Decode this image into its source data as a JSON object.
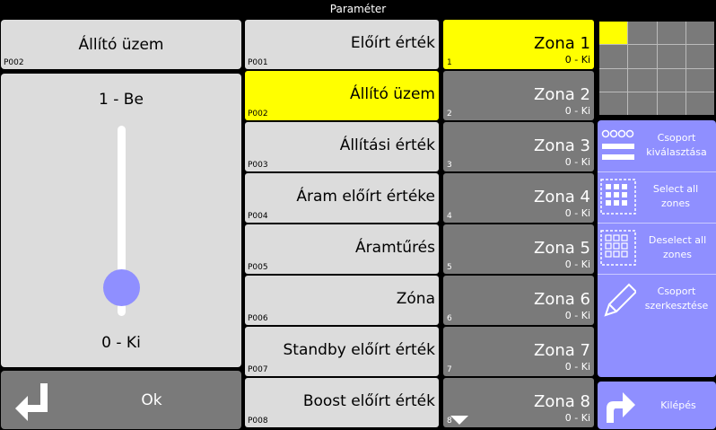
{
  "title": "Paraméter",
  "left_panel": {
    "selected_name": "Állító üzem",
    "selected_code": "P002",
    "slider": {
      "top_label": "1 - Be",
      "bottom_label": "0 - Ki",
      "value": 0
    },
    "ok_label": "Ok"
  },
  "params": [
    {
      "label": "Előírt érték",
      "code": "P001"
    },
    {
      "label": "Állító üzem",
      "code": "P002"
    },
    {
      "label": "Állítási érték",
      "code": "P003"
    },
    {
      "label": "Áram előírt értéke",
      "code": "P004"
    },
    {
      "label": "Áramtűrés",
      "code": "P005"
    },
    {
      "label": "Zóna",
      "code": "P006"
    },
    {
      "label": "Standby előírt érték",
      "code": "P007"
    },
    {
      "label": "Boost előírt érték",
      "code": "P008"
    }
  ],
  "zones": [
    {
      "name": "Zona 1",
      "value": "0 - Ki",
      "num": "1"
    },
    {
      "name": "Zona 2",
      "value": "0 - Ki",
      "num": "2"
    },
    {
      "name": "Zona 3",
      "value": "0 - Ki",
      "num": "3"
    },
    {
      "name": "Zona 4",
      "value": "0 - Ki",
      "num": "4"
    },
    {
      "name": "Zona 5",
      "value": "0 - Ki",
      "num": "5"
    },
    {
      "name": "Zona 6",
      "value": "0 - Ki",
      "num": "6"
    },
    {
      "name": "Zona 7",
      "value": "0 - Ki",
      "num": "7"
    },
    {
      "name": "Zona 8",
      "value": "0 - Ki",
      "num": "8"
    }
  ],
  "actions": {
    "group_select": "Csoport kiválasztása",
    "select_all": "Select all zones",
    "deselect_all": "Deselect all zones",
    "group_edit": "Csoport szerkesztése",
    "exit": "Kilépés"
  },
  "colors": {
    "accent": "#ffff00",
    "action": "#8f8fff",
    "slider_knob": "#8f8fff"
  }
}
